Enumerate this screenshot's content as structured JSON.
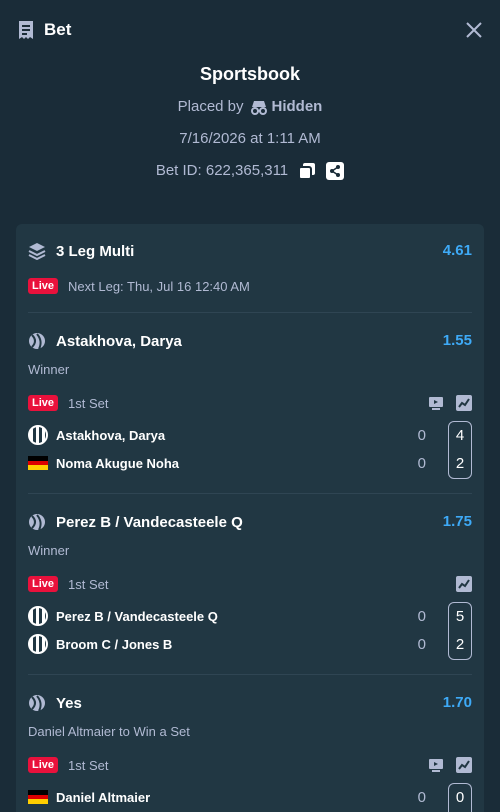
{
  "header": {
    "title": "Bet"
  },
  "summary": {
    "book": "Sportsbook",
    "placed_by_label": "Placed by",
    "placed_by_user": "Hidden",
    "datetime": "7/16/2026 at 1:11 AM",
    "bet_id": "Bet ID: 622,365,311"
  },
  "multi": {
    "title": "3 Leg Multi",
    "odds": "4.61",
    "live_label": "Live",
    "next_leg": "Next Leg: Thu, Jul 16 12:40 AM"
  },
  "legs": [
    {
      "selection": "Astakhova, Darya",
      "odds": "1.55",
      "market": "Winner",
      "live_label": "Live",
      "status": "1st Set",
      "teams": [
        {
          "name": "Astakhova, Darya",
          "sets": "0",
          "games": "4"
        },
        {
          "name": "Noma Akugue Noha",
          "sets": "0",
          "games": "2"
        }
      ]
    },
    {
      "selection": "Perez B / Vandecasteele Q",
      "odds": "1.75",
      "market": "Winner",
      "live_label": "Live",
      "status": "1st Set",
      "teams": [
        {
          "name": "Perez B / Vandecasteele Q",
          "sets": "0",
          "games": "5"
        },
        {
          "name": "Broom C / Jones B",
          "sets": "0",
          "games": "2"
        }
      ]
    },
    {
      "selection": "Yes",
      "odds": "1.70",
      "market": "Daniel Altmaier to Win a Set",
      "live_label": "Live",
      "status": "1st Set",
      "teams": [
        {
          "name": "Daniel Altmaier",
          "sets": "0",
          "games": "0"
        }
      ]
    }
  ],
  "colors": {
    "accent": "#3eaaf7",
    "live": "#e9113c",
    "bg": "#1a2c38",
    "card": "#213743"
  }
}
